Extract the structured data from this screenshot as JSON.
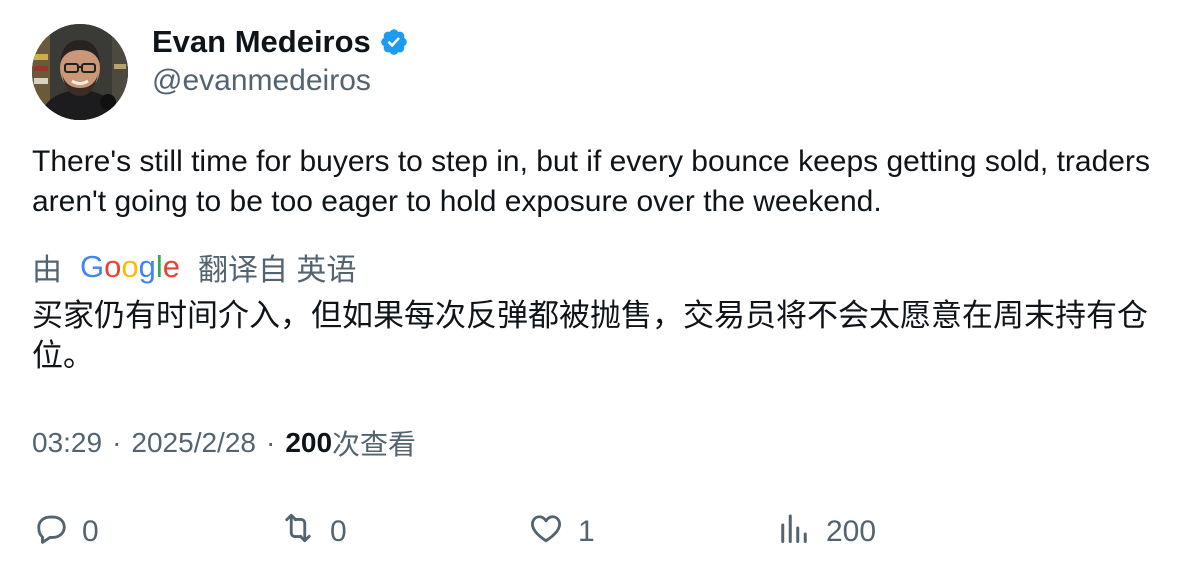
{
  "author": {
    "display_name": "Evan Medeiros",
    "handle": "@evanmedeiros"
  },
  "tweet": {
    "text": "There's still time for buyers to step in, but if every bounce keeps getting sold, traders aren't going to be too eager to hold exposure over the weekend."
  },
  "translation": {
    "prefix": "由",
    "provider": "Google",
    "suffix": "翻译自 英语",
    "text": "买家仍有时间介入，但如果每次反弹都被抛售，交易员将不会太愿意在周末持有仓位。"
  },
  "meta": {
    "time": "03:29",
    "separator": "·",
    "date": "2025/2/28",
    "views_count": "200",
    "views_label": "次查看"
  },
  "actions": {
    "reply_count": "0",
    "retweet_count": "0",
    "like_count": "1",
    "views_count": "200"
  },
  "colors": {
    "text_primary": "#0f1419",
    "text_secondary": "#536471",
    "verified_blue": "#1d9bf0"
  },
  "icons": {
    "verified": "verified-badge-icon",
    "reply": "reply-icon",
    "retweet": "retweet-icon",
    "like": "heart-icon",
    "views": "analytics-icon"
  }
}
